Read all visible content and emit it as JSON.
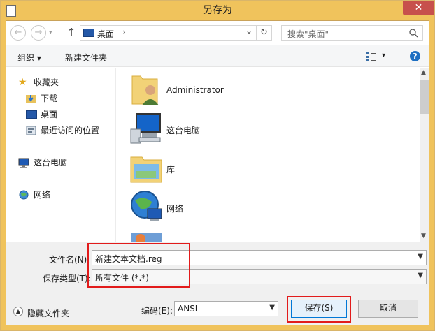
{
  "window": {
    "title": "另存为",
    "close_glyph": "✕"
  },
  "nav": {
    "back_glyph": "←",
    "forward_glyph": "→",
    "up_glyph": "↑",
    "refresh_glyph": "↻",
    "address": "桌面",
    "address_chevron": "›",
    "address_dropdown": "⌄",
    "search_placeholder": "搜索\"桌面\""
  },
  "toolbar": {
    "organize_label": "组织 ▾",
    "new_folder_label": "新建文件夹",
    "view_dropdown": "▾",
    "help_glyph": "?"
  },
  "sidebar": {
    "items": [
      {
        "label": "收藏夹",
        "icon": "star-icon"
      },
      {
        "label": "下载",
        "icon": "download-folder-icon"
      },
      {
        "label": "桌面",
        "icon": "desktop-icon"
      },
      {
        "label": "最近访问的位置",
        "icon": "recent-places-icon"
      },
      {
        "label": "这台电脑",
        "icon": "computer-icon"
      },
      {
        "label": "网络",
        "icon": "network-icon"
      }
    ]
  },
  "files": [
    {
      "label": "Administrator",
      "icon": "user-folder-icon"
    },
    {
      "label": "这台电脑",
      "icon": "computer-icon"
    },
    {
      "label": "库",
      "icon": "library-icon"
    },
    {
      "label": "网络",
      "icon": "network-globe-icon"
    }
  ],
  "form": {
    "filename_label": "文件名(N):",
    "filename_value": "新建文本文档.reg",
    "filetype_label": "保存类型(T):",
    "filetype_value": "所有文件  (*.*)",
    "encoding_label": "编码(E):",
    "encoding_value": "ANSI",
    "hide_folders_label": "隐藏文件夹",
    "save_label": "保存(S)",
    "cancel_label": "取消"
  },
  "colors": {
    "title_bar": "#f0c35c",
    "close_button": "#c7504c",
    "highlight_box": "#e21b1b"
  }
}
